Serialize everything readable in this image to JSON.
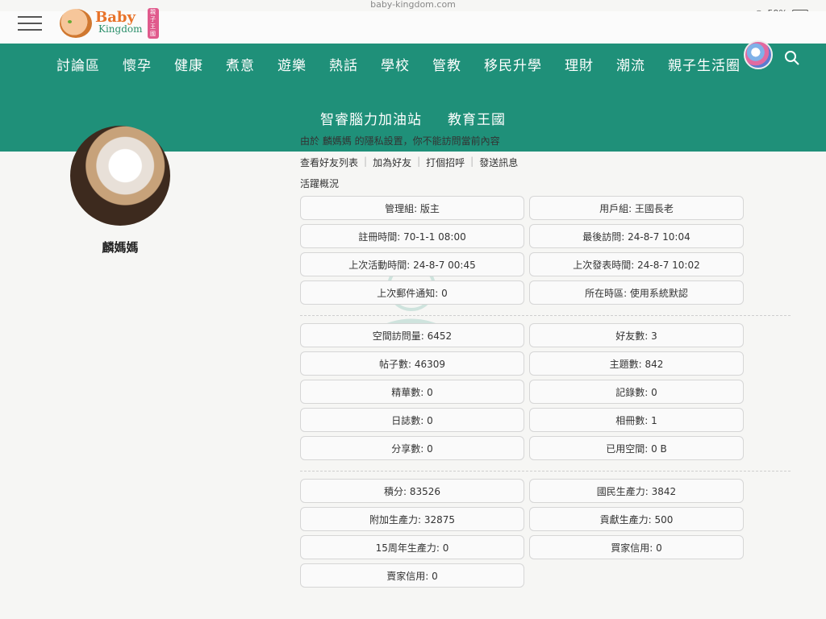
{
  "browser": {
    "url": "baby-kingdom.com",
    "battery": "59%"
  },
  "logo": {
    "line1": "Baby",
    "line2": "Kingdom",
    "badge": "親子王國"
  },
  "nav": {
    "row1": [
      "討論區",
      "懷孕",
      "健康",
      "煮意",
      "遊樂",
      "熱話",
      "學校",
      "管教",
      "移民升學",
      "理財",
      "潮流",
      "親子生活圈"
    ],
    "row2": [
      "智睿腦力加油站",
      "教育王國"
    ]
  },
  "profile": {
    "name": "麟媽媽"
  },
  "main": {
    "privacy_note": "由於 麟媽媽 的隱私設置，你不能訪問當前內容",
    "actions": [
      "查看好友列表",
      "加為好友",
      "打個招呼",
      "發送訊息"
    ],
    "activity_title": "活躍概況",
    "section1": [
      "管理組: 版主",
      "用戶組: 王國長老",
      "註冊時間: 70-1-1 08:00",
      "最後訪問: 24-8-7 10:04",
      "上次活動時間: 24-8-7 00:45",
      "上次發表時間: 24-8-7 10:02",
      "上次郵件通知: 0",
      "所在時區: 使用系統默認"
    ],
    "section2": [
      "空間訪問量: 6452",
      "好友數: 3",
      "帖子數: 46309",
      "主題數: 842",
      "精華數: 0",
      "記錄數: 0",
      "日誌數: 0",
      "相冊數: 1",
      "分享數: 0",
      "已用空間: 0 B"
    ],
    "section3": [
      "積分: 83526",
      "國民生產力: 3842",
      "附加生產力: 32875",
      "貢獻生產力: 500",
      "15周年生產力: 0",
      "買家信用: 0",
      "賣家信用: 0"
    ]
  }
}
